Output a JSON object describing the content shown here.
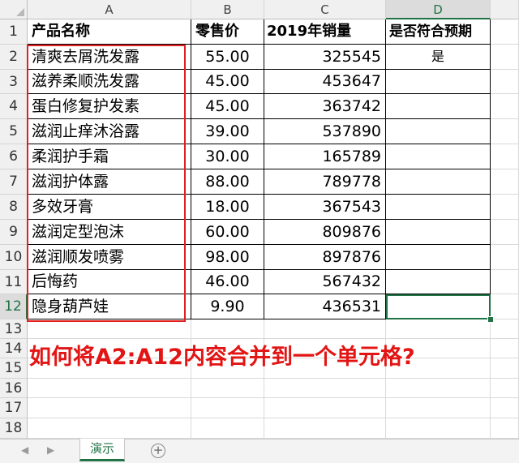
{
  "columns": [
    "A",
    "B",
    "C",
    "D"
  ],
  "row_numbers": [
    "1",
    "2",
    "3",
    "4",
    "5",
    "6",
    "7",
    "8",
    "9",
    "10",
    "11",
    "12",
    "13",
    "14",
    "15",
    "16",
    "17",
    "18"
  ],
  "header": {
    "product_name": "产品名称",
    "retail_price": "零售价",
    "sales_2019": "2019年销量",
    "meets_expectation": "是否符合预期"
  },
  "rows": [
    {
      "name": "清爽去屑洗发露",
      "price": "55.00",
      "sales": "325545",
      "meets": "是"
    },
    {
      "name": "滋养柔顺洗发露",
      "price": "45.00",
      "sales": "453647",
      "meets": ""
    },
    {
      "name": "蛋白修复护发素",
      "price": "45.00",
      "sales": "363742",
      "meets": ""
    },
    {
      "name": "滋润止痒沐浴露",
      "price": "39.00",
      "sales": "537890",
      "meets": ""
    },
    {
      "name": "柔润护手霜",
      "price": "30.00",
      "sales": "165789",
      "meets": ""
    },
    {
      "name": "滋润护体露",
      "price": "88.00",
      "sales": "789778",
      "meets": ""
    },
    {
      "name": "多效牙膏",
      "price": "18.00",
      "sales": "367543",
      "meets": ""
    },
    {
      "name": "滋润定型泡沫",
      "price": "60.00",
      "sales": "809876",
      "meets": ""
    },
    {
      "name": "滋润顺发喷雾",
      "price": "98.00",
      "sales": "897876",
      "meets": ""
    },
    {
      "name": "后悔药",
      "price": "46.00",
      "sales": "567432",
      "meets": ""
    },
    {
      "name": "隐身葫芦娃",
      "price": "9.90",
      "sales": "436531",
      "meets": ""
    }
  ],
  "annotation_text": "如何将A2:A12内容合并到一个单元格?",
  "sheet_tab": "演示",
  "add_sheet_symbol": "+",
  "nav_prev": "◀",
  "nav_next": "▶",
  "selected_cell": "D12",
  "colors": {
    "accent_green": "#217346",
    "highlight_red": "#e02020",
    "annotation_red": "#e31414"
  }
}
